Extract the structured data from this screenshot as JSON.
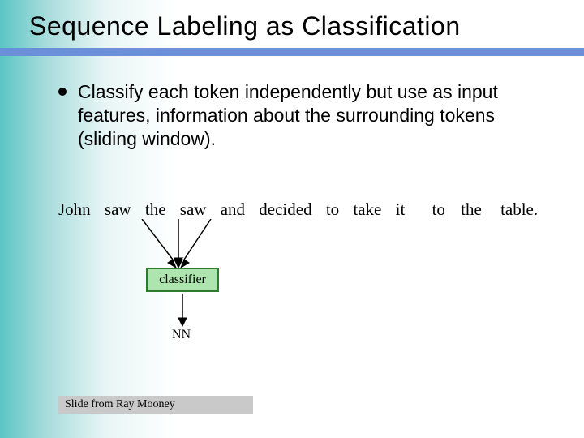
{
  "title": "Sequence Labeling as Classification",
  "bullet": "Classify each token independently but use as input features, information about the surrounding tokens (sliding window).",
  "sentence": {
    "tokens": [
      "John",
      "saw",
      "the",
      "saw",
      "and",
      "decided",
      "to",
      "take",
      "it",
      "to",
      "the",
      "table."
    ]
  },
  "classifier_label": "classifier",
  "output_label": "NN",
  "attribution": "Slide from Ray Mooney"
}
